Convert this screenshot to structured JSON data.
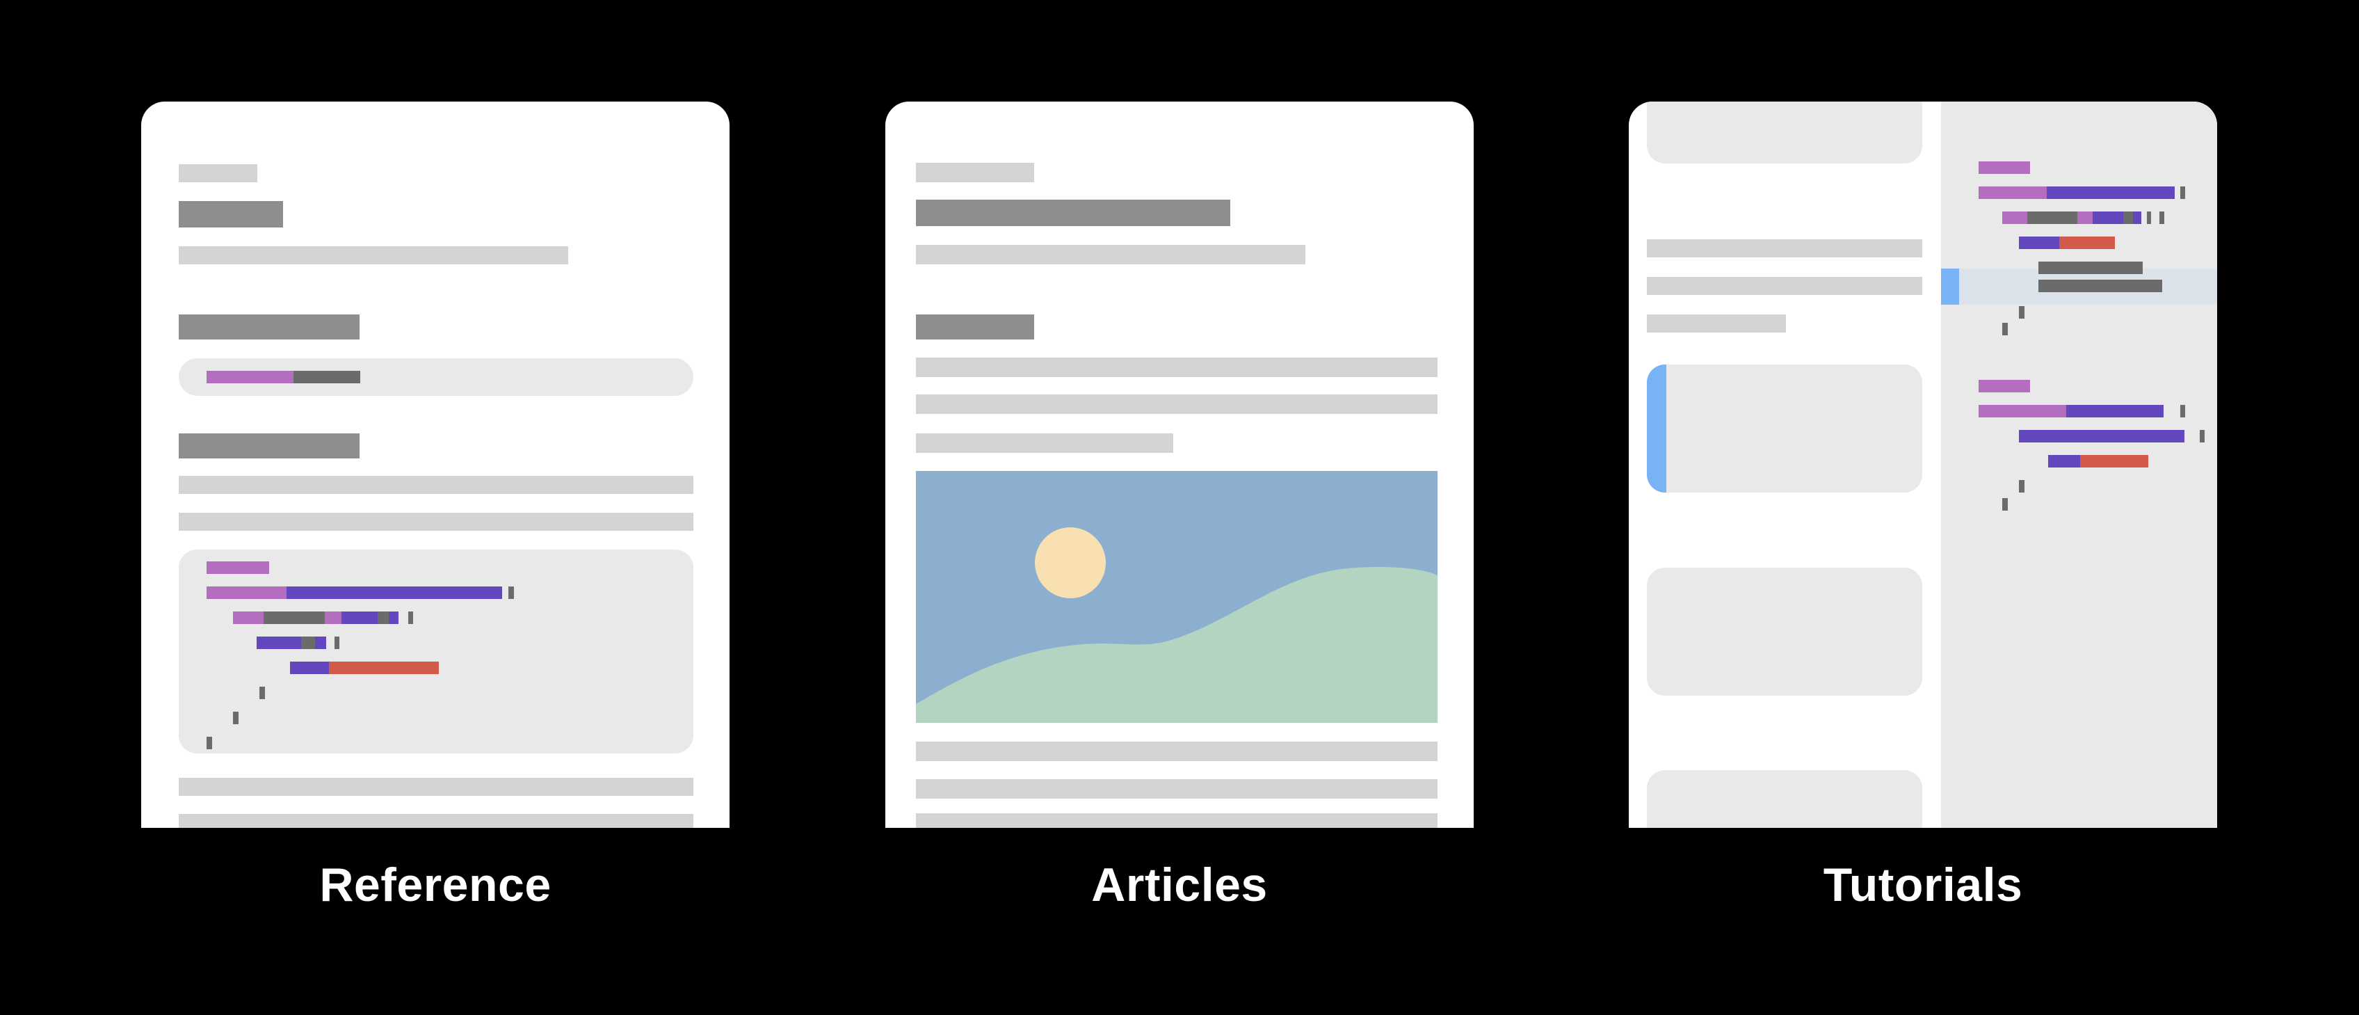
{
  "captions": {
    "reference": "Reference",
    "articles": "Articles",
    "tutorials": "Tutorials"
  },
  "colors": {
    "background": "#000000",
    "card": "#ffffff",
    "placeholder_light": "#d4d4d4",
    "placeholder_dark": "#8e8e8e",
    "panel": "#e9e9e9",
    "code_pink": "#b46ebf",
    "code_purple": "#6347bf",
    "code_gray": "#6b6b6b",
    "code_red": "#d25a4b",
    "accent_blue": "#78b4f5",
    "highlight_row": "#dde3ea",
    "sky": "#8cafcf",
    "sun": "#f8e0b3",
    "hill": "#b3d4c0"
  },
  "icons": {
    "landscape": "landscape-image-icon"
  }
}
